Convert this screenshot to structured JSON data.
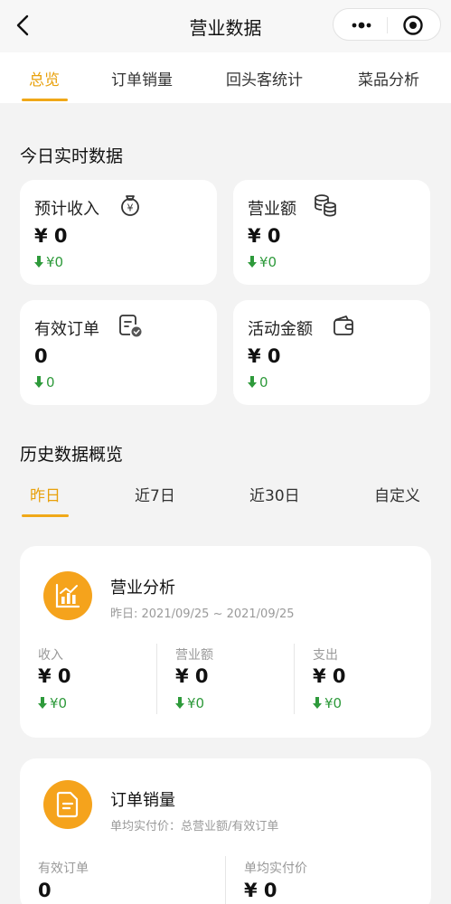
{
  "header": {
    "title": "营业数据"
  },
  "top_tabs": [
    "总览",
    "订单销量",
    "回头客统计",
    "菜品分析"
  ],
  "realtime": {
    "title": "今日实时数据",
    "cards": [
      {
        "label": "预计收入",
        "value": "¥ 0",
        "delta": "¥0"
      },
      {
        "label": "营业额",
        "value": "¥ 0",
        "delta": "¥0"
      },
      {
        "label": "有效订单",
        "value": "0",
        "delta": "0"
      },
      {
        "label": "活动金额",
        "value": "¥ 0",
        "delta": "0"
      }
    ]
  },
  "history": {
    "title": "历史数据概览",
    "tabs": [
      "昨日",
      "近7日",
      "近30日",
      "自定义"
    ]
  },
  "business": {
    "title": "营业分析",
    "subtitle": "昨日: 2021/09/25 ~ 2021/09/25",
    "metrics": [
      {
        "label": "收入",
        "value": "¥ 0",
        "delta": "¥0"
      },
      {
        "label": "营业额",
        "value": "¥ 0",
        "delta": "¥0"
      },
      {
        "label": "支出",
        "value": "¥ 0",
        "delta": "¥0"
      }
    ]
  },
  "orders": {
    "title": "订单销量",
    "subtitle": "单均实付价：总营业额/有效订单",
    "metrics": [
      {
        "label": "有效订单",
        "value": "0"
      },
      {
        "label": "单均实付价",
        "value": "¥ 0"
      }
    ]
  },
  "colors": {
    "accent": "#f0a818",
    "positive": "#2e9a3b"
  }
}
